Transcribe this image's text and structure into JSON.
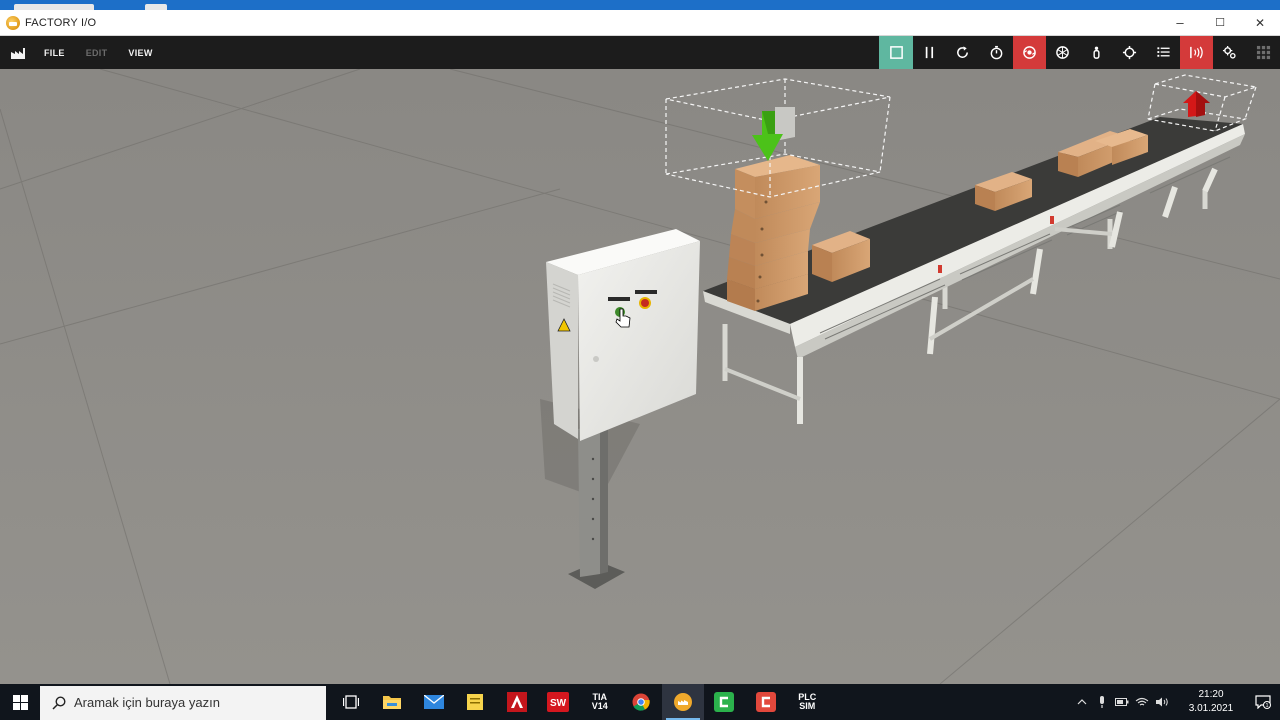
{
  "window": {
    "title": "FACTORY I/O",
    "minimize": "–",
    "maximize": "☐",
    "close": "✕"
  },
  "menu": {
    "file": "FILE",
    "edit": "EDIT",
    "view": "VIEW"
  },
  "toolbar": {
    "tools": [
      {
        "name": "stop-icon",
        "state": "active"
      },
      {
        "name": "pause-icon"
      },
      {
        "name": "reset-icon"
      },
      {
        "name": "timer-icon"
      },
      {
        "name": "camera-orbit-icon",
        "state": "active"
      },
      {
        "name": "fly-camera-icon"
      },
      {
        "name": "first-person-icon"
      },
      {
        "name": "target-icon"
      },
      {
        "name": "list-icon"
      },
      {
        "name": "sensors-icon",
        "state": "active"
      },
      {
        "name": "drivers-icon"
      },
      {
        "name": "grid-icon"
      }
    ],
    "colors": {
      "active_green": "#5fb7a0",
      "active_red": "#d43a3a"
    }
  },
  "scene": {
    "objects": [
      "emitter",
      "control-box",
      "stacked-boxes",
      "belt-conveyor",
      "remover"
    ]
  },
  "taskbar": {
    "search_placeholder": "Aramak için buraya yazın",
    "apps": [
      {
        "name": "task-view-icon"
      },
      {
        "name": "file-explorer-icon"
      },
      {
        "name": "mail-icon"
      },
      {
        "name": "notes-icon"
      },
      {
        "name": "autocad-icon"
      },
      {
        "name": "solidworks-icon",
        "label": "SW"
      },
      {
        "name": "tia-portal-icon",
        "label": "TIA V14"
      },
      {
        "name": "chrome-icon"
      },
      {
        "name": "factory-io-icon",
        "state": "active"
      },
      {
        "name": "camtasia-green-icon"
      },
      {
        "name": "camtasia-red-icon"
      },
      {
        "name": "plcsim-icon",
        "label": "PLC SIM"
      }
    ],
    "clock": {
      "time": "21:20",
      "date": "3.01.2021"
    }
  }
}
